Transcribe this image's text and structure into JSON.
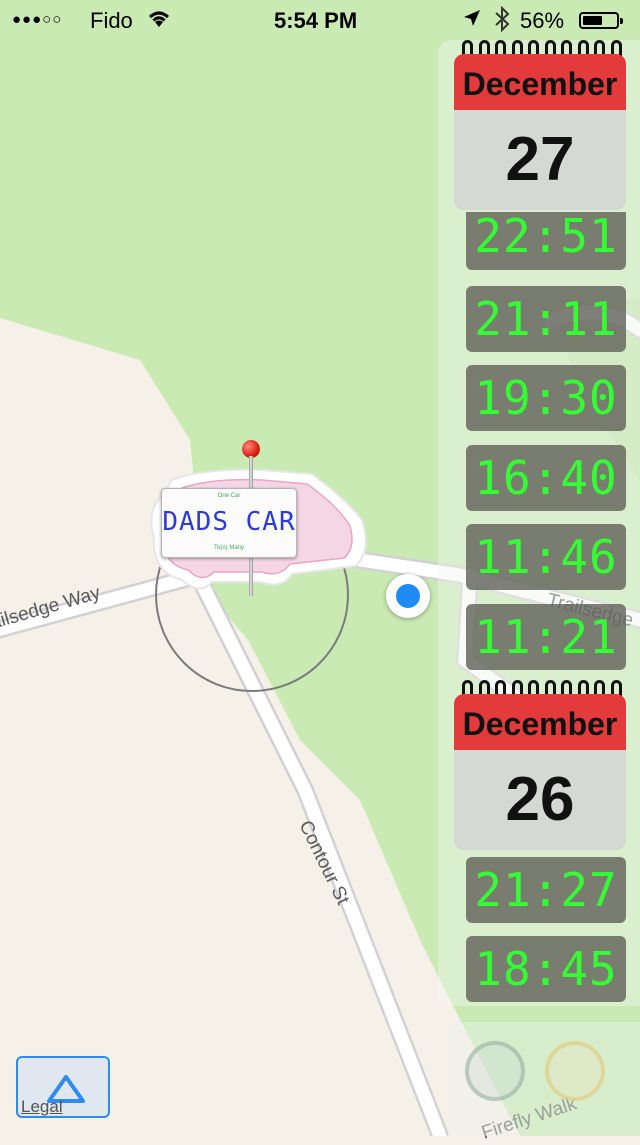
{
  "status_bar": {
    "signal": "●●●○○",
    "carrier": "Fido",
    "time": "5:54 PM",
    "battery": "56%"
  },
  "map": {
    "streets": [
      "Trailsedge Way",
      "Trailsedge",
      "Contour St",
      "Firefly Walk"
    ],
    "colors": {
      "land": "#f6f1e8",
      "park": "#c9eab3",
      "road": "#ffffff"
    }
  },
  "parked_car": {
    "plate_top": "One Car",
    "plate_text": "DADS CAR",
    "plate_bottom": "To(o) Many"
  },
  "timeline": {
    "days": [
      {
        "month": "December",
        "day": "27",
        "times": [
          "22:51",
          "21:11",
          "19:30",
          "16:40",
          "11:46",
          "11:21"
        ]
      },
      {
        "month": "December",
        "day": "26",
        "times": [
          "21:27",
          "18:45"
        ]
      }
    ]
  },
  "legal": "Legal",
  "icons": [
    "location-arrow-icon",
    "bluetooth-icon",
    "wifi-icon",
    "battery-icon",
    "map-pin-icon",
    "user-location-icon",
    "tracking-triangle-icon"
  ]
}
